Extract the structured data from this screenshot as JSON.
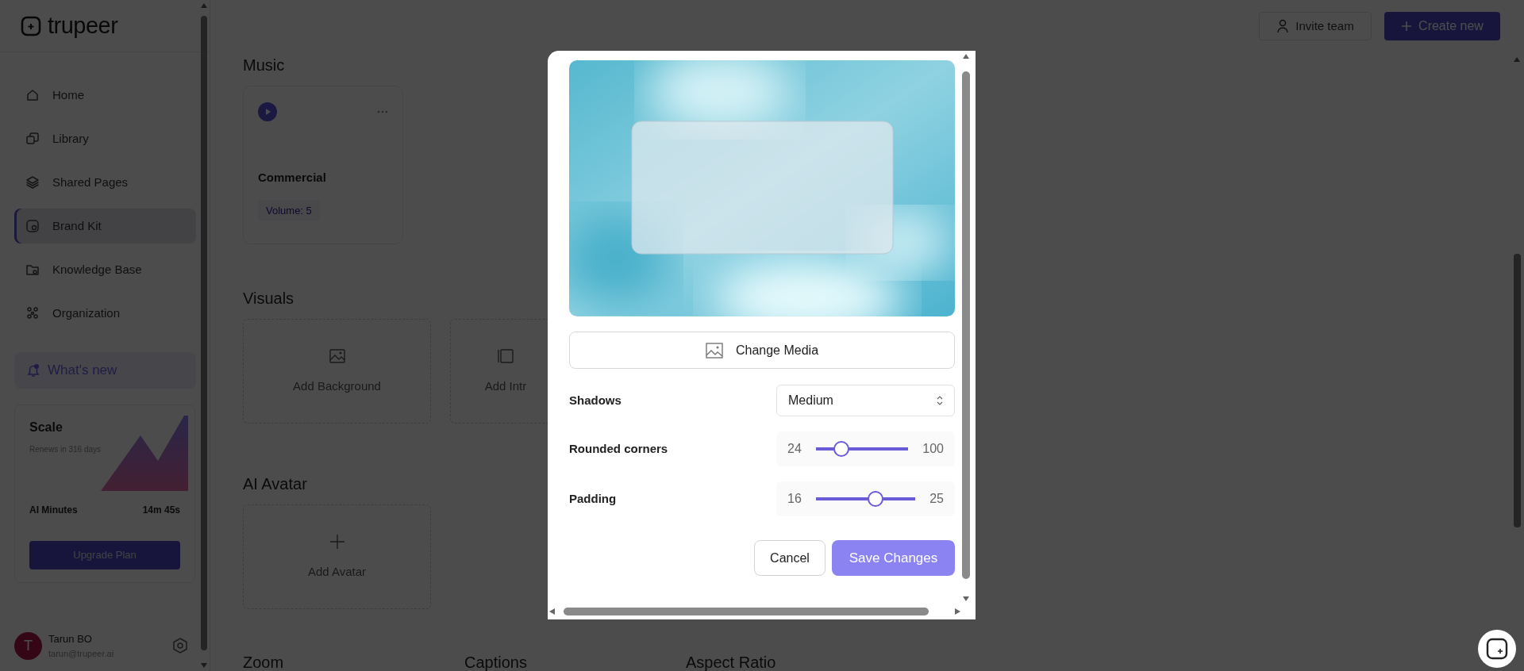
{
  "sidebar": {
    "logo": "trupeer",
    "items": [
      {
        "label": "Home",
        "selected": false
      },
      {
        "label": "Library",
        "selected": false
      },
      {
        "label": "Shared Pages",
        "selected": false
      },
      {
        "label": "Brand Kit",
        "selected": true
      },
      {
        "label": "Knowledge Base",
        "selected": false
      },
      {
        "label": "Organization",
        "selected": false
      }
    ],
    "whats_new": "What's new",
    "plan": {
      "name": "Scale",
      "renews": "Renews in 316 days",
      "minutes_label": "AI Minutes",
      "minutes_value": "14m 45s",
      "upgrade": "Upgrade Plan"
    },
    "user": {
      "initial": "T",
      "name": "Tarun BO",
      "email": "tarun@trupeer.ai"
    }
  },
  "header": {
    "invite": "Invite team",
    "create": "Create new"
  },
  "sections": [
    {
      "title": "Music",
      "kind": "music",
      "cards": [
        {
          "title": "Commercial",
          "tag": "Volume: 5"
        }
      ]
    },
    {
      "title": "Visuals",
      "kind": "tiles",
      "cards": [
        {
          "label": "Add Background"
        },
        {
          "label": "Add Intr"
        }
      ]
    },
    {
      "title": "AI Avatar",
      "kind": "tiles",
      "cards": [
        {
          "label": "Add Avatar"
        }
      ]
    }
  ],
  "bottom_headings": [
    "Zoom",
    "Captions",
    "Aspect Ratio"
  ],
  "modal": {
    "change_media": "Change Media",
    "settings": [
      {
        "kind": "select",
        "label": "Shadows",
        "value": "Medium"
      },
      {
        "kind": "slider",
        "label": "Rounded corners",
        "reading": "24",
        "max": "100",
        "level": 0.28
      },
      {
        "kind": "slider",
        "label": "Padding",
        "reading": "16",
        "max": "25",
        "level": 0.6
      }
    ],
    "cancel": "Cancel",
    "save": "Save Changes"
  }
}
